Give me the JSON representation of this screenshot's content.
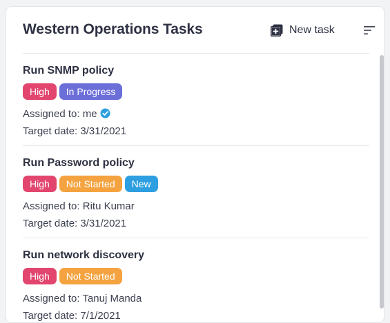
{
  "header": {
    "title": "Western Operations Tasks",
    "new_task_label": "New task",
    "new_task_icon": "add-square-icon",
    "sort_icon": "filter-lines-icon"
  },
  "colors": {
    "high": "#e2466f",
    "in_progress": "#6c6fd8",
    "not_started": "#f4a340",
    "new": "#2d9fe0",
    "verified": "#2d9fe0"
  },
  "tasks": [
    {
      "name": "Run SNMP policy",
      "badges": [
        "High",
        "In Progress"
      ],
      "assigned_label": "Assigned to:",
      "assigned_value": "me",
      "target_label": "Target date:",
      "target_value": "3/31/2021"
    },
    {
      "name": "Run Password policy",
      "badges": [
        "High",
        "Not Started",
        "New"
      ],
      "assigned_label": "Assigned to:",
      "assigned_value": "Ritu Kumar",
      "target_label": "Target date:",
      "target_value": "3/31/2021"
    },
    {
      "name": "Run network discovery",
      "badges": [
        "High",
        "Not Started"
      ],
      "assigned_label": "Assigned to:",
      "assigned_value": "Tanuj Manda",
      "target_label": "Target date:",
      "target_value": "7/1/2021"
    }
  ]
}
